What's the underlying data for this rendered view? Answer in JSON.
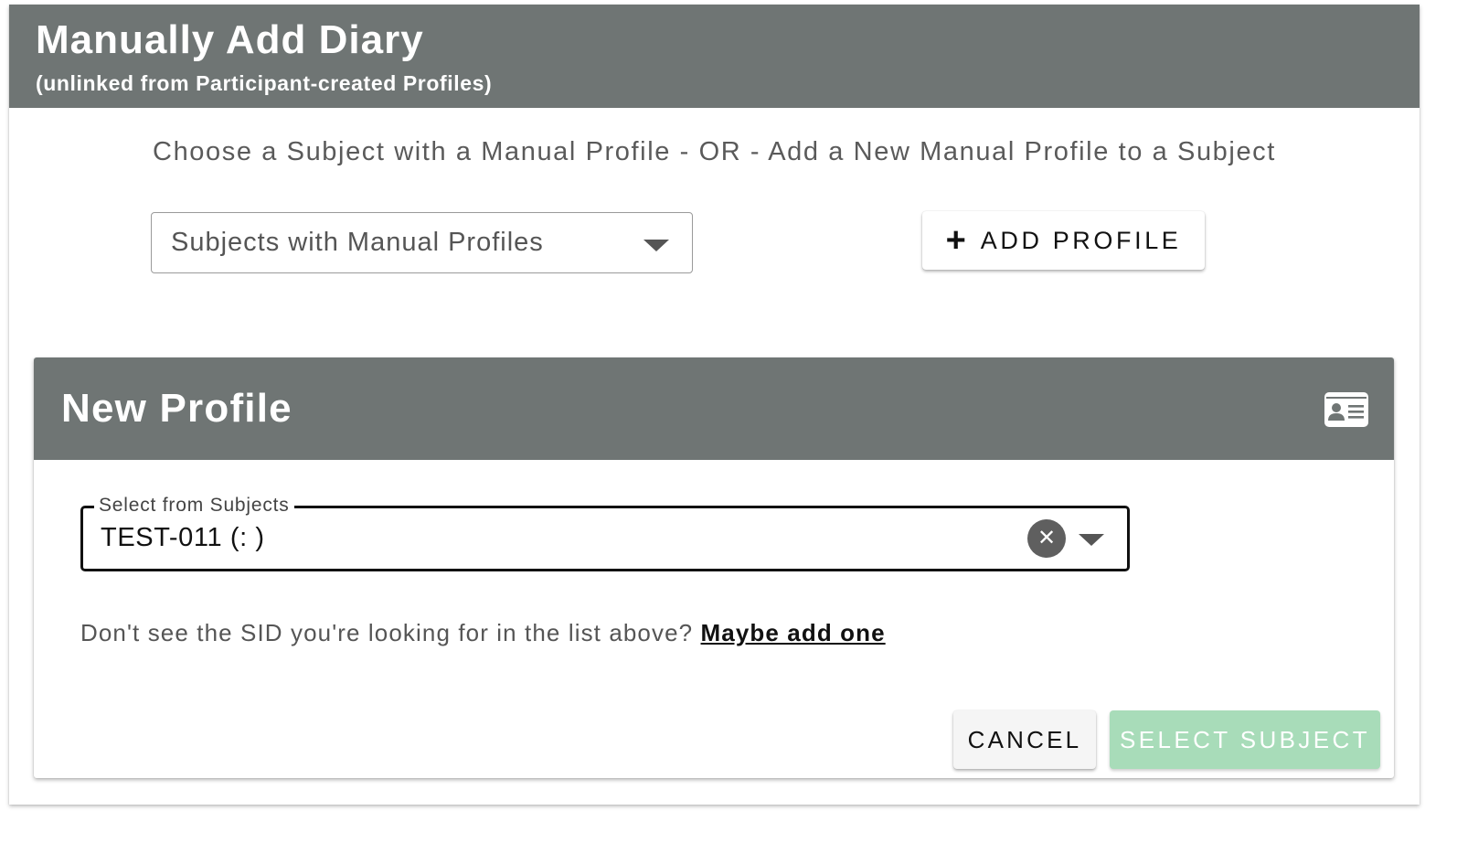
{
  "dialog": {
    "title": "Manually Add Diary",
    "subtitle": "(unlinked from Participant-created Profiles)",
    "instruction": "Choose a Subject with a Manual Profile - OR - Add a New Manual Profile to a Subject",
    "subjects_select": {
      "placeholder": "Subjects with Manual Profiles",
      "icon": "chevron-down-icon"
    },
    "add_profile_button": {
      "icon": "plus-icon",
      "label": "ADD PROFILE"
    }
  },
  "new_profile": {
    "title": "New Profile",
    "header_icon": "id-card-icon",
    "subject_field": {
      "label": "Select from Subjects",
      "value": "TEST-011 (: )",
      "clear_icon": "clear-icon",
      "dropdown_icon": "chevron-down-icon"
    },
    "hint": {
      "text": "Don't see the SID you're looking for in the list above?",
      "link": "Maybe add one"
    },
    "buttons": {
      "cancel": "CANCEL",
      "select": "SELECT SUBJECT"
    }
  },
  "colors": {
    "header_bg": "#6f7574",
    "primary_disabled": "#a8dcb9",
    "text_dark": "#111111",
    "text_muted": "#555555"
  }
}
